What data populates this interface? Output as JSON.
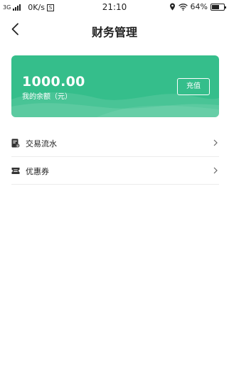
{
  "status_bar": {
    "network_type": "3G",
    "speed": "0K/s",
    "speed_badge": "S",
    "time": "21:10",
    "battery": "64%",
    "battery_level": 0.64
  },
  "header": {
    "title": "财务管理",
    "back_icon": "chevron-left-icon"
  },
  "balance": {
    "amount": "1000.00",
    "label": "我的余额（元）",
    "recharge_label": "充值",
    "card_color": "#35be8b"
  },
  "menu": [
    {
      "label": "交易流水",
      "icon": "receipt-icon"
    },
    {
      "label": "优惠券",
      "icon": "coupon-icon"
    }
  ]
}
